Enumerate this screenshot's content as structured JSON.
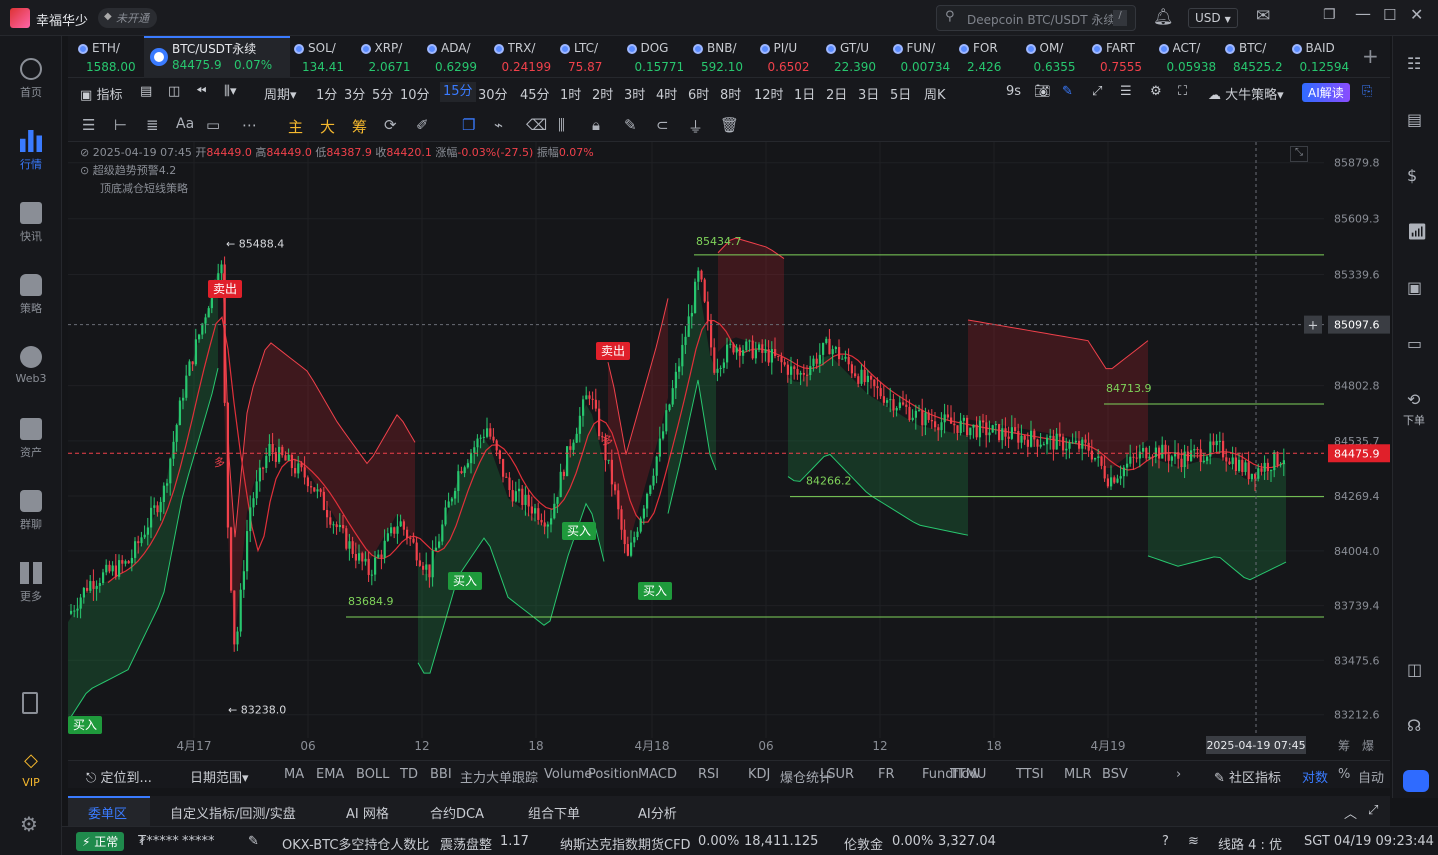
{
  "app": {
    "user_name": "幸福华少",
    "badge": "未开通",
    "search_placeholder": "Deepcoin BTC/USDT 永续",
    "search_shortcut": "/",
    "currency": "USD"
  },
  "sidebar": [
    {
      "label": "首页"
    },
    {
      "label": "行情"
    },
    {
      "label": "快讯"
    },
    {
      "label": "策略"
    },
    {
      "label": "Web3"
    },
    {
      "label": "资产"
    },
    {
      "label": "群聊"
    },
    {
      "label": "更多"
    }
  ],
  "sidebar_bottom": {
    "vip": "VIP"
  },
  "tickers": [
    {
      "name": "ETH/",
      "price": "1588.00",
      "dir": "g"
    },
    {
      "name": "BTC/USDT永续",
      "price": "84475.9",
      "change": "0.07%",
      "dir": "g"
    },
    {
      "name": "SOL/",
      "price": "134.41",
      "dir": "g"
    },
    {
      "name": "XRP/",
      "price": "2.0671",
      "dir": "g"
    },
    {
      "name": "ADA/",
      "price": "0.6299",
      "dir": "g"
    },
    {
      "name": "TRX/",
      "price": "0.24199",
      "dir": "r"
    },
    {
      "name": "LTC/",
      "price": "75.87",
      "dir": "r"
    },
    {
      "name": "DOG",
      "price": "0.15771",
      "dir": "g"
    },
    {
      "name": "BNB/",
      "price": "592.10",
      "dir": "g"
    },
    {
      "name": "PI/U",
      "price": "0.6502",
      "dir": "r"
    },
    {
      "name": "GT/U",
      "price": "22.390",
      "dir": "g"
    },
    {
      "name": "FUN/",
      "price": "0.00734",
      "dir": "g"
    },
    {
      "name": "FOR",
      "price": "2.426",
      "dir": "g"
    },
    {
      "name": "OM/",
      "price": "0.6355",
      "dir": "g"
    },
    {
      "name": "FART",
      "price": "0.7555",
      "dir": "r"
    },
    {
      "name": "ACT/",
      "price": "0.05938",
      "dir": "g"
    },
    {
      "name": "BTC/",
      "price": "84525.2",
      "dir": "g"
    },
    {
      "name": "BAID",
      "price": "0.12594",
      "dir": "g"
    }
  ],
  "periods": {
    "left": [
      "指标",
      "周期"
    ],
    "items": [
      "1分",
      "3分",
      "5分",
      "10分",
      "15分",
      "30分",
      "45分",
      "1时",
      "2时",
      "3时",
      "4时",
      "6时",
      "8时",
      "12时",
      "1日",
      "2日",
      "3日",
      "5日",
      "周K"
    ],
    "active": "15分",
    "right": {
      "countdown": "9s",
      "strategy": "大牛策略",
      "ai": "AI解读"
    }
  },
  "toolbar_labels": [
    "Aa",
    "主",
    "大",
    "筹"
  ],
  "chart_data": {
    "type": "candlestick",
    "ohlc_header": {
      "time": "2025-04-19 07:45",
      "open_label": "开",
      "open": "84449.0",
      "high_label": "高",
      "high": "84449.0",
      "low_label": "低",
      "low": "84387.9",
      "close_label": "收",
      "close": "84420.1",
      "chg_label": "涨幅",
      "chg": "-0.03%(-27.5)",
      "amp_label": "振幅",
      "amp": "0.07%"
    },
    "indicators": [
      "超级趋势预警4.2",
      "顶底减仓短线策略"
    ],
    "y_ticks": [
      85879.8,
      85609.3,
      85339.6,
      85097.6,
      84802.8,
      84535.7,
      84475.9,
      84269.4,
      84004.0,
      83739.4,
      83475.6,
      83212.6
    ],
    "ylim": [
      83100,
      85980
    ],
    "x_ticks": [
      "4月17",
      "06",
      "12",
      "18",
      "4月18",
      "06",
      "12",
      "18",
      "4月19"
    ],
    "crosshair_time": "2025-04-19 07:45",
    "crosshair_price": "85097.6",
    "last_price": "84475.9",
    "annotations": {
      "high_label": "85488.4",
      "low_label": "83238.0",
      "peak2": "85434.7",
      "lvl1": "84713.9",
      "lvl2": "84266.2",
      "lvl3": "83684.9"
    },
    "signals": {
      "sell": "卖出",
      "buy": "买入",
      "long": "多"
    }
  },
  "indicator_bar": {
    "left": [
      "定位到...",
      "日期范围"
    ],
    "items": [
      "MA",
      "EMA",
      "BOLL",
      "TD",
      "BBI",
      "主力大单跟踪",
      "Volume",
      "Position",
      "MACD",
      "RSI",
      "KDJ",
      "爆仓统计",
      "LSUR",
      "FR",
      "Fundflow",
      "TTMU",
      "TTSI",
      "MLR",
      "BSV"
    ],
    "right": [
      "社区指标",
      "对数",
      "%",
      "自动"
    ],
    "corner": [
      "筹",
      "爆"
    ]
  },
  "bottom_tabs": [
    "委单区",
    "自定义指标/回测/实盘",
    "AI 网格",
    "合约DCA",
    "组合下单",
    "AI分析"
  ],
  "status": {
    "mode": "正常",
    "masked1": "₮*****",
    "masked2": "*****",
    "t1_name": "OKX-BTC多空持仓人数比",
    "t1_state": "震荡盘整",
    "t1_val": "1.17",
    "t2_name": "纳斯达克指数期货CFD",
    "t2_chg": "0.00%",
    "t2_val": "18,411.125",
    "t3_name": "伦敦金",
    "t3_chg": "0.00%",
    "t3_val": "3,327.04",
    "line": "线路 4 : 优",
    "time": "SGT 04/19 09:23:44"
  },
  "rail_labels": [
    "下单"
  ],
  "colors": {
    "up": "#28c76f",
    "down": "#f0414b",
    "accent": "#3a7bff",
    "bg": "#151619"
  }
}
